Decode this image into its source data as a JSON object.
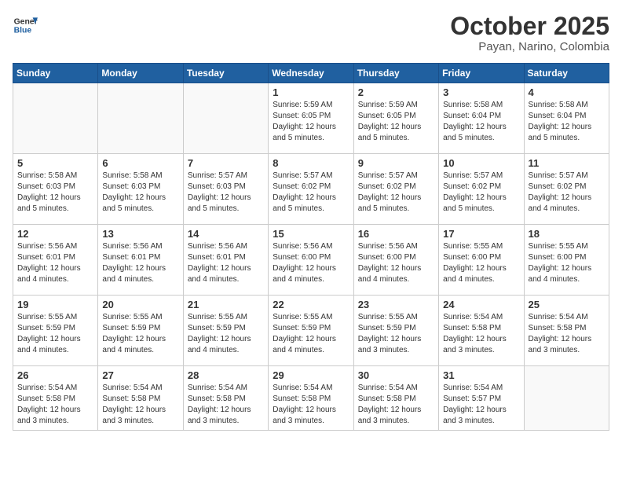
{
  "header": {
    "logo_general": "General",
    "logo_blue": "Blue",
    "month": "October 2025",
    "location": "Payan, Narino, Colombia"
  },
  "weekdays": [
    "Sunday",
    "Monday",
    "Tuesday",
    "Wednesday",
    "Thursday",
    "Friday",
    "Saturday"
  ],
  "weeks": [
    [
      {
        "day": "",
        "info": ""
      },
      {
        "day": "",
        "info": ""
      },
      {
        "day": "",
        "info": ""
      },
      {
        "day": "1",
        "info": "Sunrise: 5:59 AM\nSunset: 6:05 PM\nDaylight: 12 hours\nand 5 minutes."
      },
      {
        "day": "2",
        "info": "Sunrise: 5:59 AM\nSunset: 6:05 PM\nDaylight: 12 hours\nand 5 minutes."
      },
      {
        "day": "3",
        "info": "Sunrise: 5:58 AM\nSunset: 6:04 PM\nDaylight: 12 hours\nand 5 minutes."
      },
      {
        "day": "4",
        "info": "Sunrise: 5:58 AM\nSunset: 6:04 PM\nDaylight: 12 hours\nand 5 minutes."
      }
    ],
    [
      {
        "day": "5",
        "info": "Sunrise: 5:58 AM\nSunset: 6:03 PM\nDaylight: 12 hours\nand 5 minutes."
      },
      {
        "day": "6",
        "info": "Sunrise: 5:58 AM\nSunset: 6:03 PM\nDaylight: 12 hours\nand 5 minutes."
      },
      {
        "day": "7",
        "info": "Sunrise: 5:57 AM\nSunset: 6:03 PM\nDaylight: 12 hours\nand 5 minutes."
      },
      {
        "day": "8",
        "info": "Sunrise: 5:57 AM\nSunset: 6:02 PM\nDaylight: 12 hours\nand 5 minutes."
      },
      {
        "day": "9",
        "info": "Sunrise: 5:57 AM\nSunset: 6:02 PM\nDaylight: 12 hours\nand 5 minutes."
      },
      {
        "day": "10",
        "info": "Sunrise: 5:57 AM\nSunset: 6:02 PM\nDaylight: 12 hours\nand 5 minutes."
      },
      {
        "day": "11",
        "info": "Sunrise: 5:57 AM\nSunset: 6:02 PM\nDaylight: 12 hours\nand 4 minutes."
      }
    ],
    [
      {
        "day": "12",
        "info": "Sunrise: 5:56 AM\nSunset: 6:01 PM\nDaylight: 12 hours\nand 4 minutes."
      },
      {
        "day": "13",
        "info": "Sunrise: 5:56 AM\nSunset: 6:01 PM\nDaylight: 12 hours\nand 4 minutes."
      },
      {
        "day": "14",
        "info": "Sunrise: 5:56 AM\nSunset: 6:01 PM\nDaylight: 12 hours\nand 4 minutes."
      },
      {
        "day": "15",
        "info": "Sunrise: 5:56 AM\nSunset: 6:00 PM\nDaylight: 12 hours\nand 4 minutes."
      },
      {
        "day": "16",
        "info": "Sunrise: 5:56 AM\nSunset: 6:00 PM\nDaylight: 12 hours\nand 4 minutes."
      },
      {
        "day": "17",
        "info": "Sunrise: 5:55 AM\nSunset: 6:00 PM\nDaylight: 12 hours\nand 4 minutes."
      },
      {
        "day": "18",
        "info": "Sunrise: 5:55 AM\nSunset: 6:00 PM\nDaylight: 12 hours\nand 4 minutes."
      }
    ],
    [
      {
        "day": "19",
        "info": "Sunrise: 5:55 AM\nSunset: 5:59 PM\nDaylight: 12 hours\nand 4 minutes."
      },
      {
        "day": "20",
        "info": "Sunrise: 5:55 AM\nSunset: 5:59 PM\nDaylight: 12 hours\nand 4 minutes."
      },
      {
        "day": "21",
        "info": "Sunrise: 5:55 AM\nSunset: 5:59 PM\nDaylight: 12 hours\nand 4 minutes."
      },
      {
        "day": "22",
        "info": "Sunrise: 5:55 AM\nSunset: 5:59 PM\nDaylight: 12 hours\nand 4 minutes."
      },
      {
        "day": "23",
        "info": "Sunrise: 5:55 AM\nSunset: 5:59 PM\nDaylight: 12 hours\nand 3 minutes."
      },
      {
        "day": "24",
        "info": "Sunrise: 5:54 AM\nSunset: 5:58 PM\nDaylight: 12 hours\nand 3 minutes."
      },
      {
        "day": "25",
        "info": "Sunrise: 5:54 AM\nSunset: 5:58 PM\nDaylight: 12 hours\nand 3 minutes."
      }
    ],
    [
      {
        "day": "26",
        "info": "Sunrise: 5:54 AM\nSunset: 5:58 PM\nDaylight: 12 hours\nand 3 minutes."
      },
      {
        "day": "27",
        "info": "Sunrise: 5:54 AM\nSunset: 5:58 PM\nDaylight: 12 hours\nand 3 minutes."
      },
      {
        "day": "28",
        "info": "Sunrise: 5:54 AM\nSunset: 5:58 PM\nDaylight: 12 hours\nand 3 minutes."
      },
      {
        "day": "29",
        "info": "Sunrise: 5:54 AM\nSunset: 5:58 PM\nDaylight: 12 hours\nand 3 minutes."
      },
      {
        "day": "30",
        "info": "Sunrise: 5:54 AM\nSunset: 5:58 PM\nDaylight: 12 hours\nand 3 minutes."
      },
      {
        "day": "31",
        "info": "Sunrise: 5:54 AM\nSunset: 5:57 PM\nDaylight: 12 hours\nand 3 minutes."
      },
      {
        "day": "",
        "info": ""
      }
    ]
  ]
}
